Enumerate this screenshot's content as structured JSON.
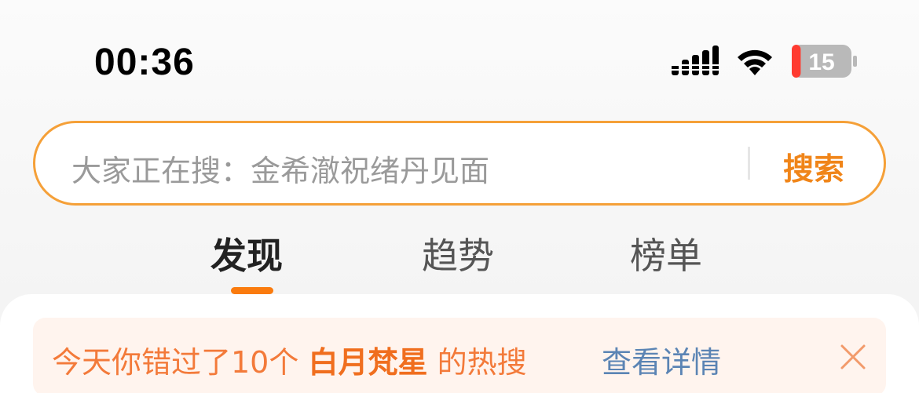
{
  "status_bar": {
    "time": "00:36",
    "battery_level": "15",
    "battery_fraction": 0.15,
    "battery_color": "#ff3b30"
  },
  "search": {
    "placeholder": "大家正在搜：金希澈祝绪丹见面",
    "button_label": "搜索",
    "accent_color": "#f5a038"
  },
  "tabs": [
    {
      "label": "发现",
      "active": true
    },
    {
      "label": "趋势",
      "active": false
    },
    {
      "label": "榜单",
      "active": false
    }
  ],
  "notice": {
    "prefix": "今天你错过了10个",
    "highlight": "白月梵星",
    "suffix": "的热搜",
    "link_label": "查看详情",
    "close_icon": "close-icon"
  }
}
